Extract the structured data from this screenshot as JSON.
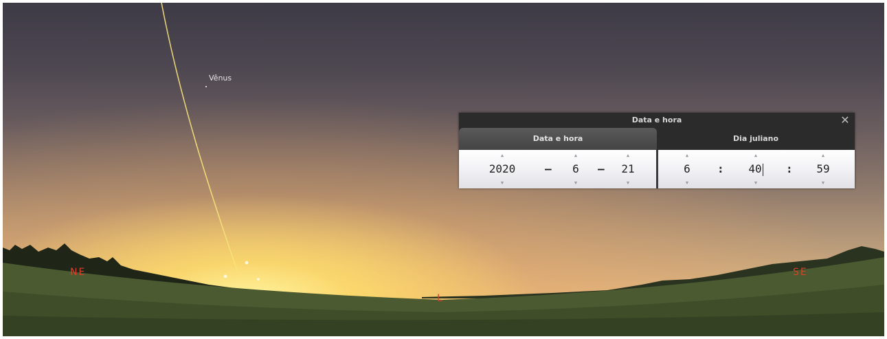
{
  "sky": {
    "planet_label": "Vênus",
    "cardinals": {
      "northeast": "NE",
      "east": "L",
      "southeast": "SE"
    },
    "cardinal_color": "#d9412a"
  },
  "dialog": {
    "title": "Data e hora",
    "close_icon": "close-icon",
    "tabs": [
      {
        "label": "Data e hora",
        "active": true
      },
      {
        "label": "Dia juliano",
        "active": false
      }
    ],
    "date": {
      "year": "2020",
      "month": "6",
      "day": "21",
      "separator": "–"
    },
    "time": {
      "hour": "6",
      "minute": "40",
      "second": "59",
      "separator": ":"
    },
    "up_arrow": "▲",
    "down_arrow": "▼"
  }
}
